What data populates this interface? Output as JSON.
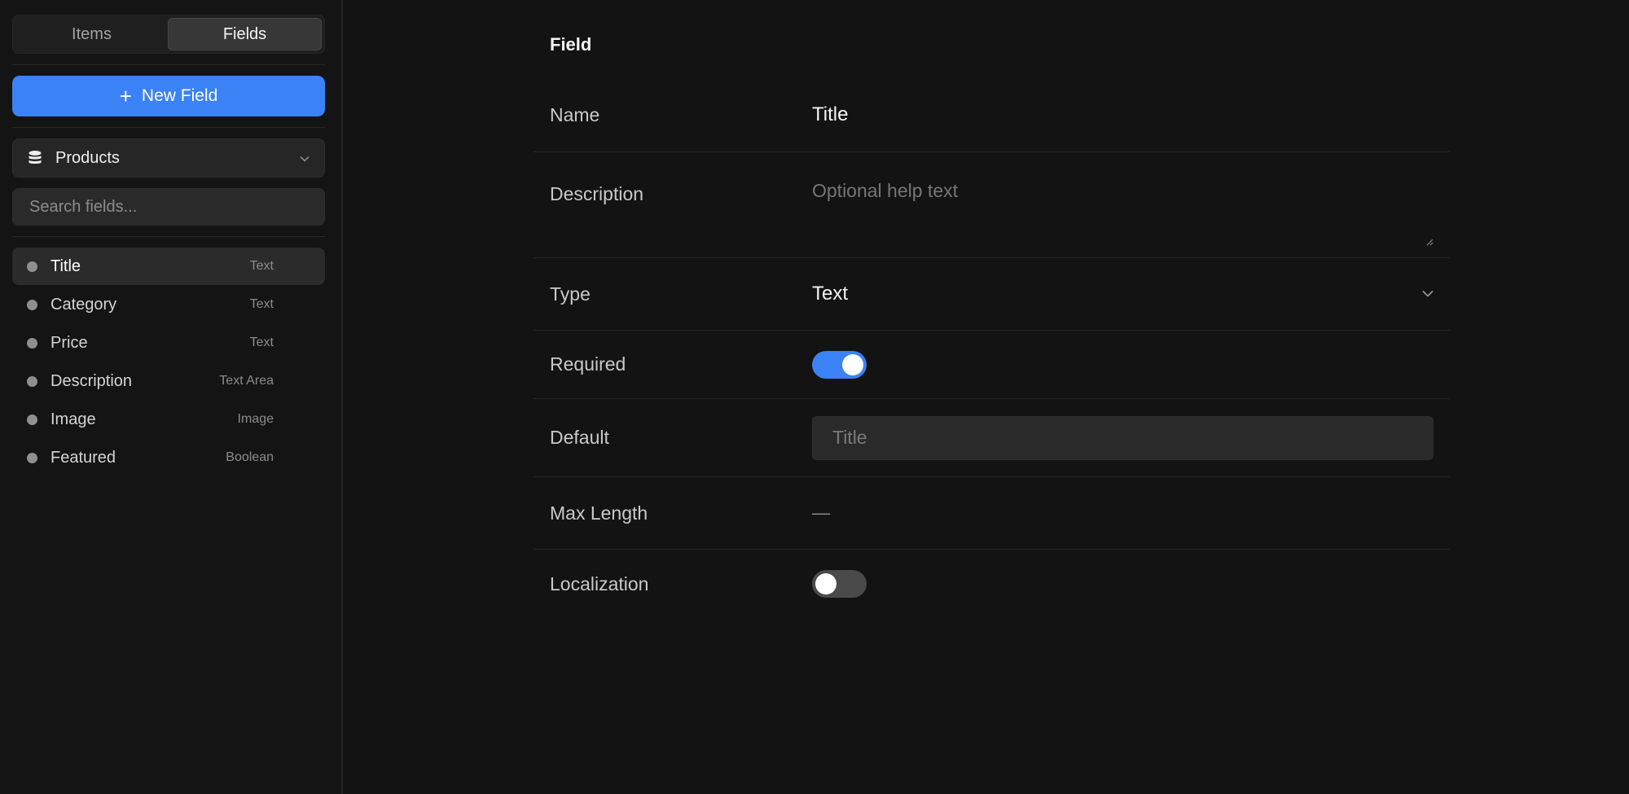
{
  "sidebar": {
    "tabs": [
      {
        "label": "Items",
        "active": false
      },
      {
        "label": "Fields",
        "active": true
      }
    ],
    "new_button": {
      "icon": "plus-icon",
      "label": "New Field"
    },
    "collection": {
      "icon": "database-icon",
      "name": "Products"
    },
    "search": {
      "placeholder": "Search fields...",
      "value": ""
    },
    "fields": [
      {
        "name": "Title",
        "type": "Text",
        "active": true
      },
      {
        "name": "Category",
        "type": "Text",
        "active": false
      },
      {
        "name": "Price",
        "type": "Text",
        "active": false
      },
      {
        "name": "Description",
        "type": "Text Area",
        "active": false
      },
      {
        "name": "Image",
        "type": "Image",
        "active": false
      },
      {
        "name": "Featured",
        "type": "Boolean",
        "active": false
      }
    ]
  },
  "form": {
    "title": "Field",
    "name": {
      "label": "Name",
      "value": "Title"
    },
    "description": {
      "label": "Description",
      "placeholder": "Optional help text",
      "value": ""
    },
    "type": {
      "label": "Type",
      "value": "Text"
    },
    "required": {
      "label": "Required",
      "on": true
    },
    "default": {
      "label": "Default",
      "placeholder": "Title",
      "value": ""
    },
    "max_length": {
      "label": "Max Length",
      "value": "—"
    },
    "localization": {
      "label": "Localization",
      "on": false
    }
  },
  "colors": {
    "accent": "#3b82f6",
    "background": "#131313",
    "toggle_off": "#4a4a4a"
  }
}
